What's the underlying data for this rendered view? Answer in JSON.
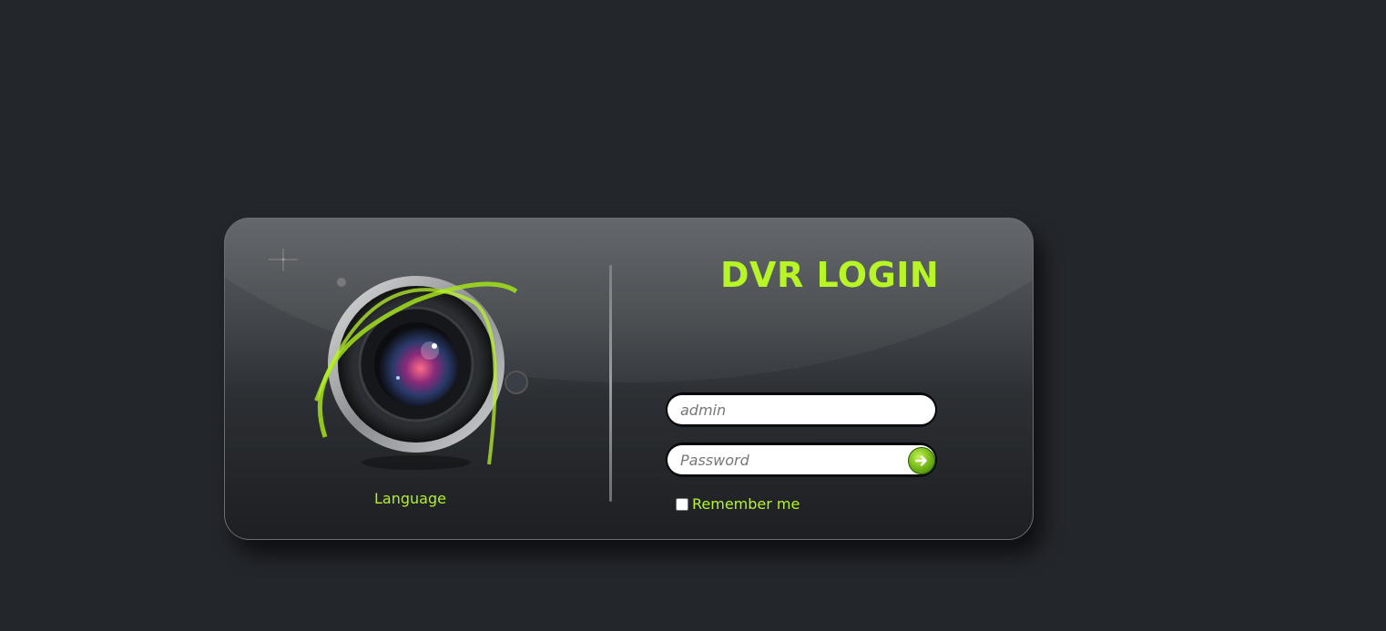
{
  "login": {
    "title": "DVR LOGIN",
    "language_label": "Language",
    "username": {
      "value": "",
      "placeholder": "admin"
    },
    "password": {
      "value": "",
      "placeholder": "Password"
    },
    "remember_label": "Remember me",
    "remember_checked": false,
    "submit_icon": "arrow-right-icon"
  },
  "colors": {
    "background": "#23262b",
    "accent": "#b8f526"
  }
}
